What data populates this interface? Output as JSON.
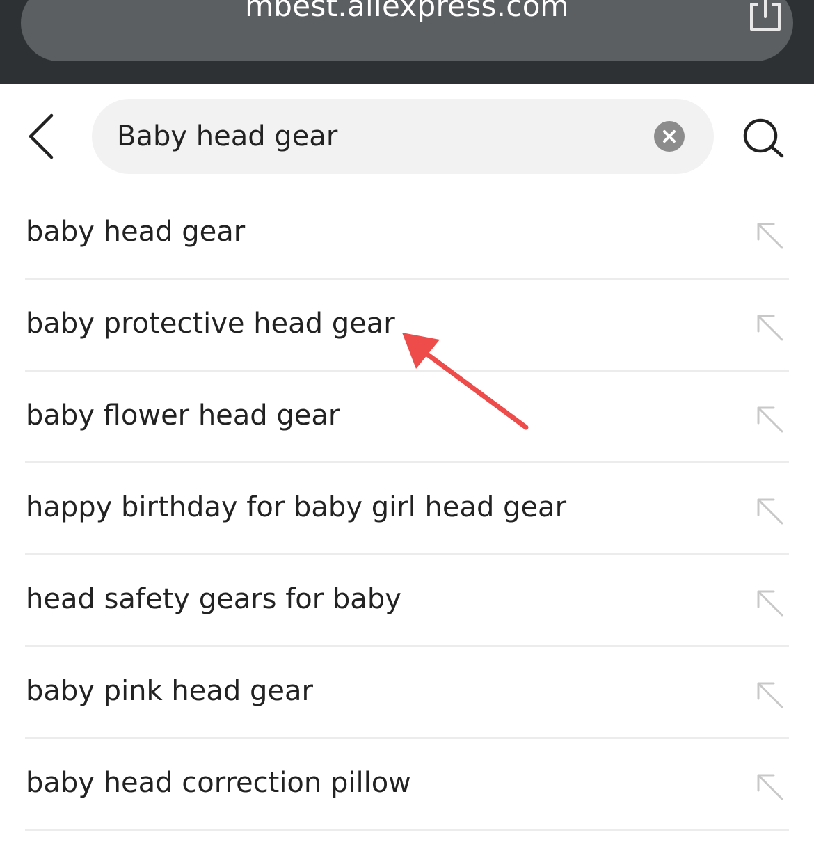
{
  "browser": {
    "url": "mbest.aliexpress.com",
    "share_icon": "share-icon"
  },
  "search": {
    "back_icon": "chevron-left-icon",
    "query": "Baby head gear",
    "clear_icon": "clear-icon",
    "search_icon": "search-icon"
  },
  "suggestions": [
    {
      "text": "baby head gear"
    },
    {
      "text": "baby protective head gear"
    },
    {
      "text": "baby flower head gear"
    },
    {
      "text": "happy birthday for baby girl head gear"
    },
    {
      "text": "head safety gears for baby"
    },
    {
      "text": "baby pink head gear"
    },
    {
      "text": "baby head correction pillow"
    }
  ],
  "colors": {
    "browser_bar": "#2e3133",
    "url_pill": "#5c5f62",
    "search_field_bg": "#f2f2f2",
    "annotation_arrow": "#ee4b4b"
  }
}
